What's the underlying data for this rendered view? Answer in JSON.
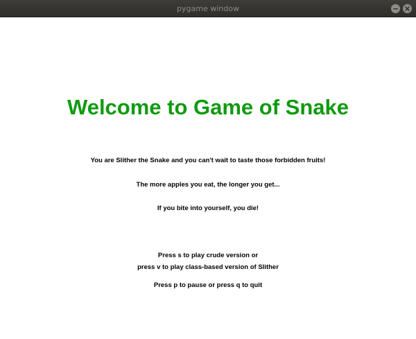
{
  "window": {
    "title": "pygame window",
    "minimize_icon": "minimize-icon",
    "close_icon": "close-icon"
  },
  "game": {
    "headline": "Welcome to Game of Snake",
    "headline_color": "#109a10",
    "text_color": "#000000",
    "background_color": "#ffffff",
    "lines": [
      "You are Slither the Snake and you can't wait to taste those forbidden fruits!",
      "The more apples you eat, the longer you get...",
      "If you bite into yourself, you die!",
      "Press s to play crude version or",
      "press v to play class-based version of Slither",
      "Press p to pause or press q to quit"
    ]
  }
}
